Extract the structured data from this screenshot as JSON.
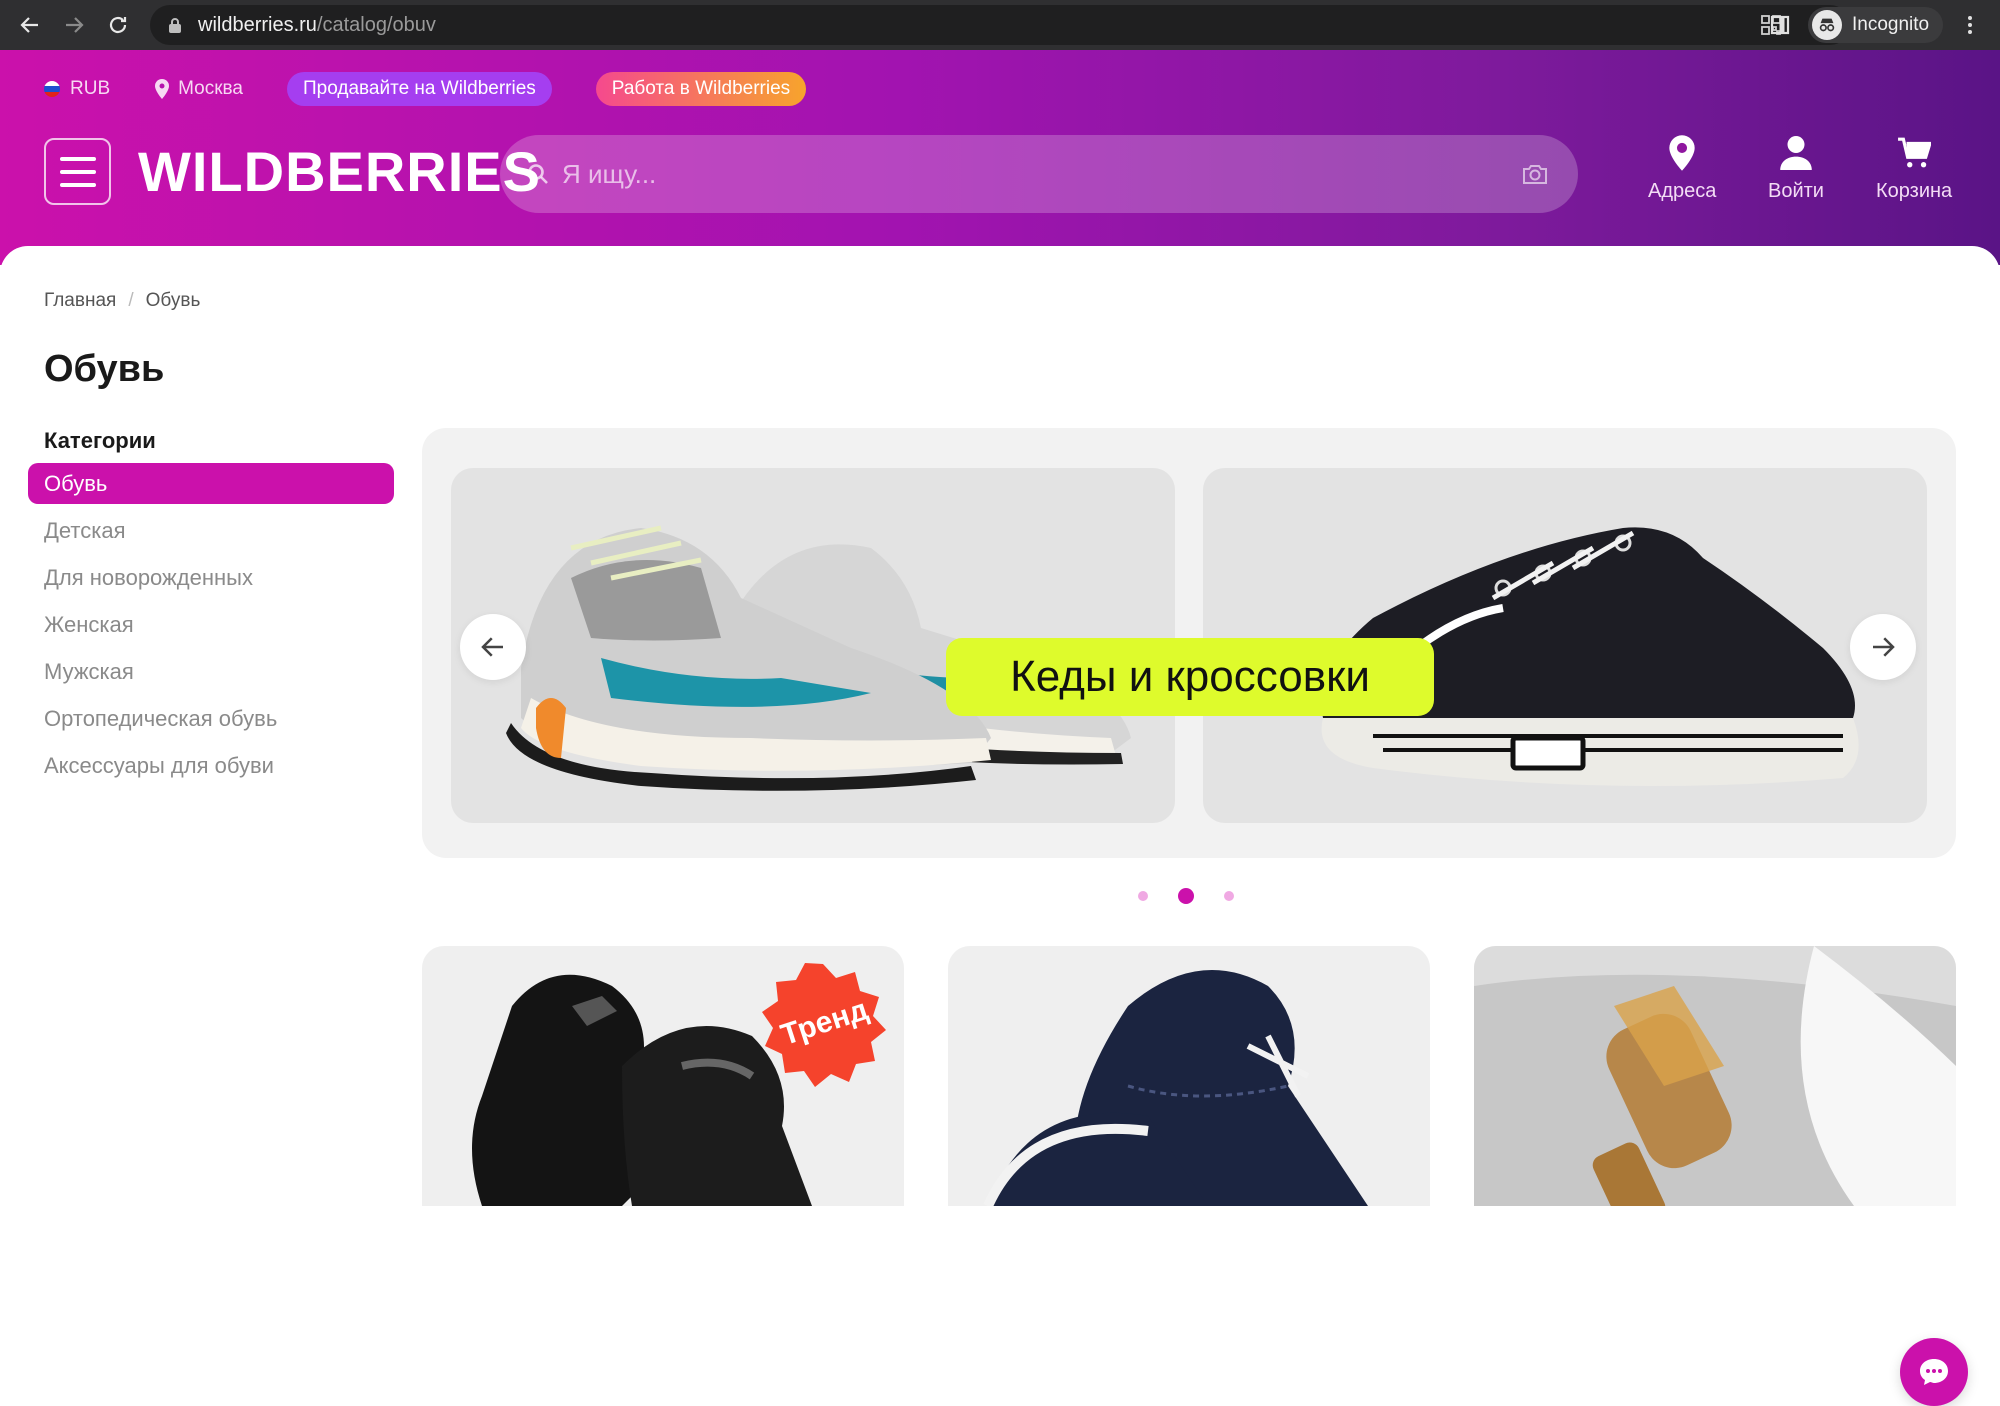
{
  "browser": {
    "url_host": "wildberries.ru",
    "url_path": "/catalog/obuv",
    "incognito_label": "Incognito"
  },
  "top_bar": {
    "currency": "RUB",
    "city": "Москва",
    "sell_label": "Продавайте на Wildberries",
    "work_label": "Работа в Wildberries"
  },
  "header": {
    "logo": "WILDBERRIES",
    "search_placeholder": "Я ищу...",
    "actions": [
      {
        "label": "Адреса",
        "icon": "location-pin-icon"
      },
      {
        "label": "Войти",
        "icon": "user-icon"
      },
      {
        "label": "Корзина",
        "icon": "cart-icon"
      }
    ]
  },
  "breadcrumb": {
    "home": "Главная",
    "separator": "/",
    "current": "Обувь"
  },
  "page_title": "Обувь",
  "categories": {
    "title": "Категории",
    "items": [
      {
        "label": "Обувь",
        "active": true
      },
      {
        "label": "Детская",
        "active": false
      },
      {
        "label": "Для новорожденных",
        "active": false
      },
      {
        "label": "Женская",
        "active": false
      },
      {
        "label": "Мужская",
        "active": false
      },
      {
        "label": "Ортопедическая обувь",
        "active": false
      },
      {
        "label": "Аксессуары для обуви",
        "active": false
      }
    ]
  },
  "banner": {
    "label": "Кеды и кроссовки",
    "slide_count": 3,
    "active_slide": 2
  },
  "cards": [
    {
      "badge": "Тренд"
    },
    {},
    {}
  ],
  "colors": {
    "brand": "#cb11ab",
    "header_end": "#5a1486",
    "banner_label_bg": "#defb2c"
  }
}
